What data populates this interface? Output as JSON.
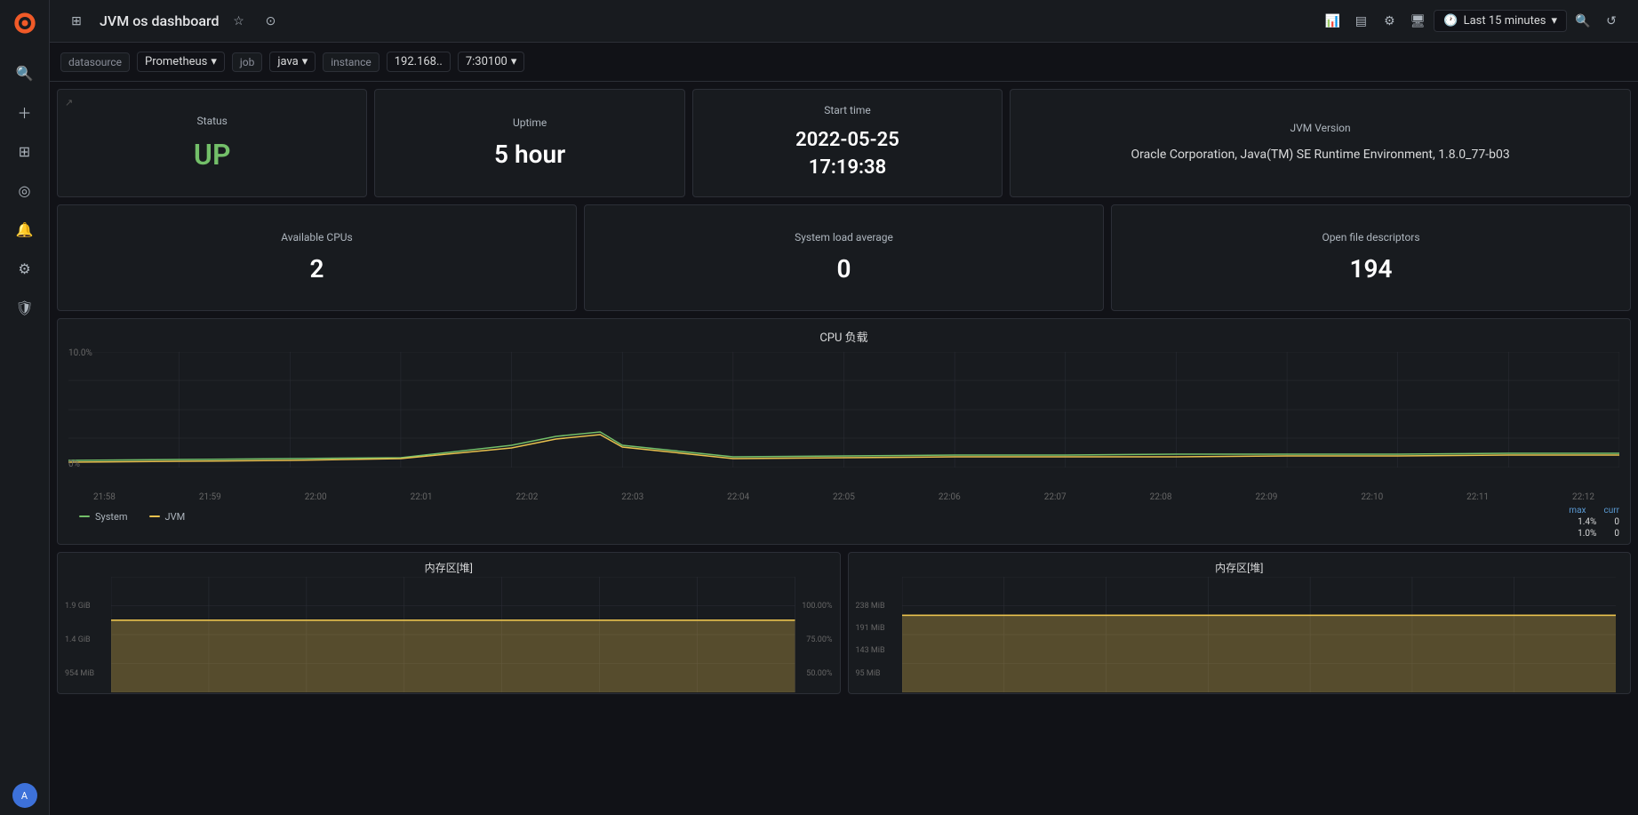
{
  "app": {
    "title": "JVM os dashboard"
  },
  "topbar": {
    "title": "JVM os dashboard",
    "time_range": "Last 15 minutes",
    "icons": [
      "grid",
      "star",
      "share",
      "chart-bar",
      "table",
      "gear",
      "monitor",
      "search",
      "refresh"
    ]
  },
  "filters": {
    "datasource_label": "datasource",
    "datasource_value": "Prometheus",
    "job_label": "job",
    "job_value": "java",
    "instance_label": "instance",
    "instance_ip": "192.168..",
    "instance_port": "7:30100"
  },
  "stats": {
    "status_label": "Status",
    "status_value": "UP",
    "uptime_label": "Uptime",
    "uptime_value": "5 hour",
    "starttime_label": "Start time",
    "starttime_value": "2022-05-25\n17:19:38",
    "jvm_label": "JVM Version",
    "jvm_value": "Oracle Corporation, Java(TM) SE Runtime Environment, 1.8.0_77-b03",
    "cpus_label": "Available CPUs",
    "cpus_value": "2",
    "load_label": "System load average",
    "load_value": "0",
    "files_label": "Open file descriptors",
    "files_value": "194"
  },
  "cpu_chart": {
    "title": "CPU 负载",
    "y_max": "10.0%",
    "y_min": "0%",
    "x_labels": [
      "21:58",
      "21:59",
      "22:00",
      "22:01",
      "22:02",
      "22:03",
      "22:04",
      "22:05",
      "22:06",
      "22:07",
      "22:08",
      "22:09",
      "22:10",
      "22:11",
      "22:12"
    ],
    "legend_system": "System",
    "legend_jvm": "JVM",
    "system_color": "#73bf69",
    "jvm_color": "#e8c14e",
    "max_label": "max",
    "curr_label": "curr",
    "system_max": "1.4%",
    "system_curr": "0",
    "jvm_max": "1.0%",
    "jvm_curr": "0"
  },
  "memory_chart1": {
    "title": "内存区[堆]",
    "y_labels": [
      "1.9 GiB",
      "1.4 GiB",
      "954 MiB"
    ],
    "y_right": [
      "100.00%",
      "75.00%",
      "50.00%"
    ]
  },
  "memory_chart2": {
    "title": "内存区[堆]",
    "y_labels": [
      "238 MiB",
      "191 MiB",
      "143 MiB",
      "95 MiB"
    ]
  }
}
